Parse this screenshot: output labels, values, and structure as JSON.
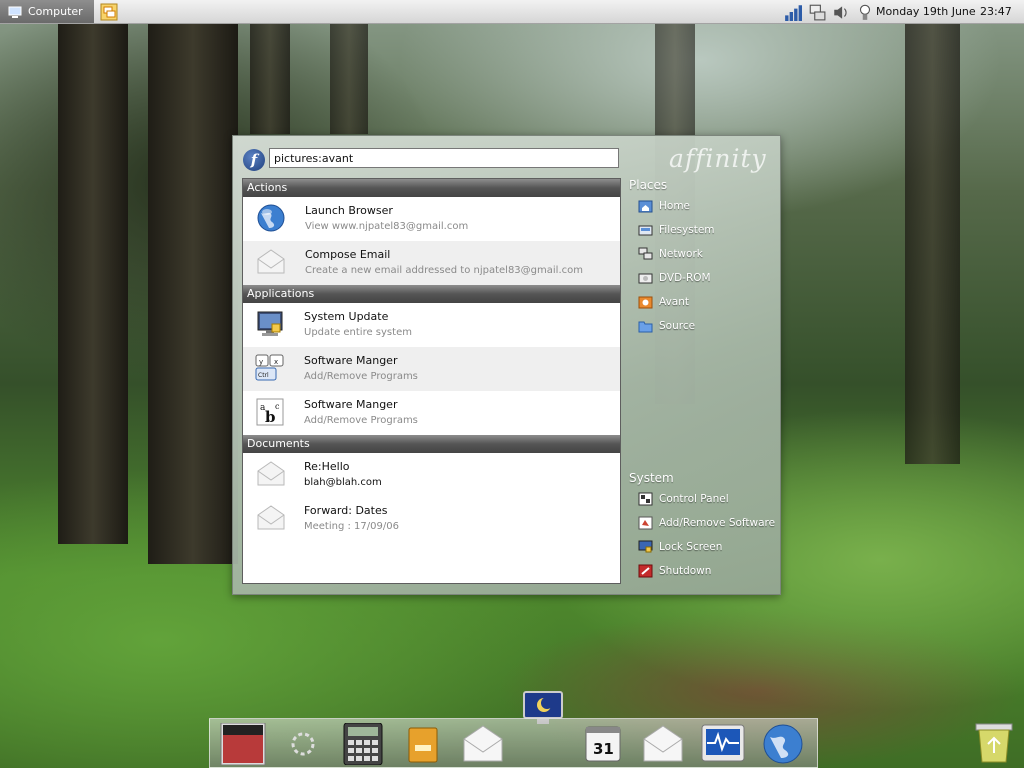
{
  "panel": {
    "computer_label": "Computer",
    "date": "Monday 19th June",
    "time": "23:47"
  },
  "launcher": {
    "search_value": "pictures:avant",
    "brand": "affinity"
  },
  "sections": {
    "actions": {
      "header": "Actions",
      "items": [
        {
          "title": "Launch Browser",
          "subtitle": "View www.njpatel83@gmail.com",
          "icon": "globe-icon"
        },
        {
          "title": "Compose Email",
          "subtitle": "Create a new email addressed to njpatel83@gmail.com",
          "icon": "envelope-icon"
        }
      ]
    },
    "applications": {
      "header": "Applications",
      "items": [
        {
          "title": "System Update",
          "subtitle": "Update entire system",
          "icon": "monitor-update-icon"
        },
        {
          "title": "Software Manger",
          "subtitle": "Add/Remove Programs",
          "icon": "keyboard-keys-icon"
        },
        {
          "title": "Software Manger",
          "subtitle": "Add/Remove Programs",
          "icon": "font-abc-icon"
        }
      ]
    },
    "documents": {
      "header": "Documents",
      "items": [
        {
          "title": "Re:Hello",
          "subtitle": "blah@blah.com",
          "icon": "envelope-icon"
        },
        {
          "title": "Forward: Dates",
          "subtitle": "Meeting : 17/09/06",
          "icon": "envelope-icon"
        }
      ]
    }
  },
  "places": {
    "header": "Places",
    "items": [
      {
        "label": "Home",
        "icon": "home-folder-icon"
      },
      {
        "label": "Filesystem",
        "icon": "drive-icon"
      },
      {
        "label": "Network",
        "icon": "network-icon"
      },
      {
        "label": "DVD-ROM",
        "icon": "dvd-icon"
      },
      {
        "label": "Avant",
        "icon": "avant-folder-icon"
      },
      {
        "label": "Source",
        "icon": "folder-icon"
      }
    ]
  },
  "system": {
    "header": "System",
    "items": [
      {
        "label": "Control Panel",
        "icon": "control-panel-icon"
      },
      {
        "label": "Add/Remove Software",
        "icon": "software-icon"
      },
      {
        "label": "Lock Screen",
        "icon": "lock-screen-icon"
      },
      {
        "label": "Shutdown",
        "icon": "shutdown-icon"
      }
    ]
  },
  "dock": {
    "calendar_day": "31",
    "items": [
      "music-album-icon",
      "update-spinner-icon",
      "calculator-icon",
      "drawer-icon",
      "mail-icon",
      "calendar-icon",
      "mail-icon",
      "system-monitor-icon",
      "globe-icon",
      "trash-icon"
    ]
  },
  "colors": {
    "section_header": "#555555",
    "panel_bg": "#e0e0e0",
    "computer_button": "#7a7a7a"
  }
}
